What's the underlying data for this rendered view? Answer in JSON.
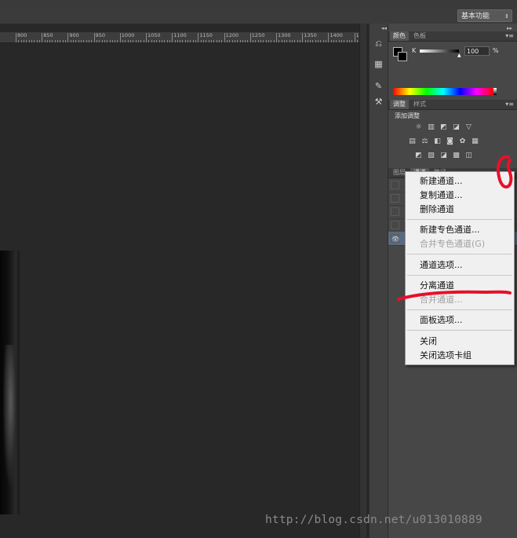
{
  "window": {
    "workspace": "基本功能"
  },
  "ruler": {
    "ticks": [
      "800",
      "850",
      "900",
      "950",
      "1000",
      "1050",
      "1100",
      "1150",
      "1200",
      "1250",
      "1300",
      "1350",
      "1400",
      "14"
    ]
  },
  "color_panel": {
    "tabs": [
      "颜色",
      "色板"
    ],
    "channel_label": "K",
    "channel_value": "100",
    "unit": "%",
    "foreground": "#000000",
    "background": "#000000"
  },
  "adjustments_panel": {
    "tabs": [
      "调整",
      "样式"
    ],
    "title": "添加调整",
    "icons_row1": [
      "brightness-contrast-icon",
      "levels-icon",
      "curves-icon",
      "exposure-icon",
      "vibrance-icon"
    ],
    "icons_row2": [
      "hue-saturation-icon",
      "color-balance-icon",
      "black-white-icon",
      "photo-filter-icon",
      "channel-mixer-icon",
      "color-lookup-icon"
    ],
    "icons_row3": [
      "invert-icon",
      "posterize-icon",
      "threshold-icon",
      "selective-color-icon",
      "gradient-map-icon"
    ]
  },
  "channels_panel": {
    "tabs": [
      "图层",
      "通道",
      "路径"
    ],
    "rows": 5,
    "selected_row": 4
  },
  "context_menu": {
    "items": [
      {
        "label": "新建通道...",
        "disabled": false
      },
      {
        "label": "复制通道...",
        "disabled": false
      },
      {
        "label": "删除通道",
        "disabled": false
      },
      {
        "label": "新建专色通道...",
        "disabled": false
      },
      {
        "label": "合并专色通道(G)",
        "disabled": true
      },
      {
        "label": "通道选项...",
        "disabled": false
      },
      {
        "label": "分离通道",
        "disabled": false
      },
      {
        "label": "合并通道...",
        "disabled": true
      },
      {
        "label": "面板选项...",
        "disabled": false
      },
      {
        "label": "关闭",
        "disabled": false
      },
      {
        "label": "关闭选项卡组",
        "disabled": false
      }
    ]
  },
  "annotation": {
    "color": "#e8102a"
  },
  "watermark": "http://blog.csdn.net/u013010889"
}
